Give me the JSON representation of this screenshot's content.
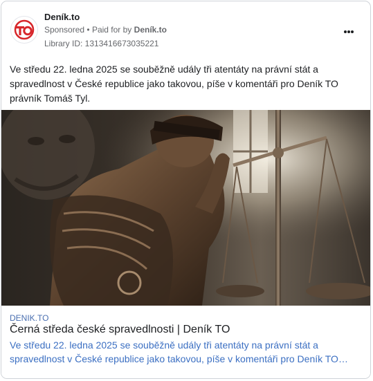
{
  "header": {
    "page_name": "Deník.to",
    "sponsored": "Sponsored",
    "paid_for_by_label": "Paid for by",
    "paid_for_by_name": "Deník.to",
    "library_id": "Library ID: 1313416673035221",
    "logo_text": "TO"
  },
  "post": {
    "text": "Ve středu 22. ledna 2025 se souběžně udály tři atentáty na právní stát a spravedlnost v České republice jako takovou, píše v komentáři pro Deník TO právník Tomáš Tyl."
  },
  "link": {
    "domain": "DENIK.TO",
    "title": "Černá středa české spravedlnosti | Deník TO",
    "description": "Ve středu 22. ledna 2025 se souběžně udály tři atentáty na právní stát a spravedlnost v České republice jako takovou, píše v komentáři pro Deník TO…"
  },
  "colors": {
    "brand_red": "#d7262a",
    "link_blue": "#3b6fc2"
  },
  "icons": {
    "more": "more-horizontal-icon"
  }
}
